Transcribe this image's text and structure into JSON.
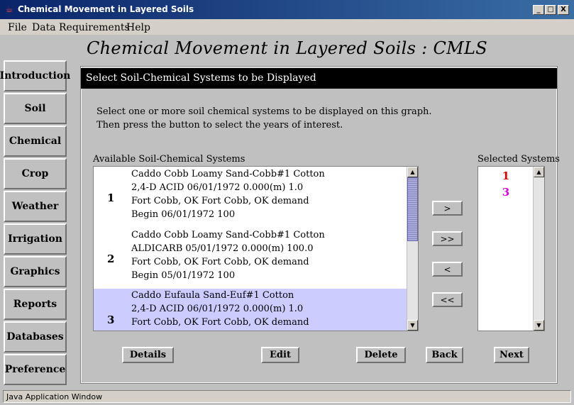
{
  "window": {
    "title": "Chemical Movement in Layered Soils",
    "min_label": "_",
    "max_label": "□",
    "close_label": "X"
  },
  "menu": [
    "File",
    "Data Requirements",
    "Help"
  ],
  "heading": "Chemical Movement in Layered Soils : CMLS",
  "sidebar": [
    "Introduction",
    "Soil",
    "Chemical",
    "Crop",
    "Weather",
    "Irrigation",
    "Graphics",
    "Reports",
    "Databases",
    "Preference"
  ],
  "panel": {
    "header": "Select Soil-Chemical Systems to be Displayed",
    "instructions": [
      "Select one or more soil chemical systems to be displayed on this  graph.",
      "Then press the button to select the years of interest."
    ],
    "available_label": "Available Soil-Chemical Systems",
    "selected_label": "Selected Systems"
  },
  "available_systems": [
    {
      "num": "1",
      "lines": [
        "Caddo Cobb Loamy Sand-Cobb#1 Cotton",
        "2,4-D ACID 06/01/1972 0.000(m) 1.0",
        "Fort Cobb, OK Fort Cobb, OK demand",
        "Begin 06/01/1972   100"
      ]
    },
    {
      "num": "2",
      "lines": [
        "Caddo Cobb Loamy Sand-Cobb#1 Cotton",
        "ALDICARB 05/01/1972 0.000(m) 100.0",
        "Fort Cobb, OK Fort Cobb, OK demand",
        "Begin 05/01/1972   100"
      ]
    },
    {
      "num": "3",
      "lines": [
        "Caddo Eufaula Sand-Euf#1 Cotton",
        "2,4-D ACID 06/01/1972 0.000(m) 1.0",
        "Fort Cobb, OK Fort Cobb, OK demand"
      ]
    }
  ],
  "selected_systems": [
    {
      "num": "1",
      "color": "#e00000"
    },
    {
      "num": "3",
      "color": "#e000e0"
    }
  ],
  "move_buttons": [
    ">",
    ">>",
    "<",
    "<<"
  ],
  "bottom_buttons": [
    "Details",
    "Edit",
    "Delete",
    "Back",
    "Next"
  ],
  "scroll_arrows": {
    "up": "▲",
    "down": "▼"
  },
  "status": "Java Application Window"
}
